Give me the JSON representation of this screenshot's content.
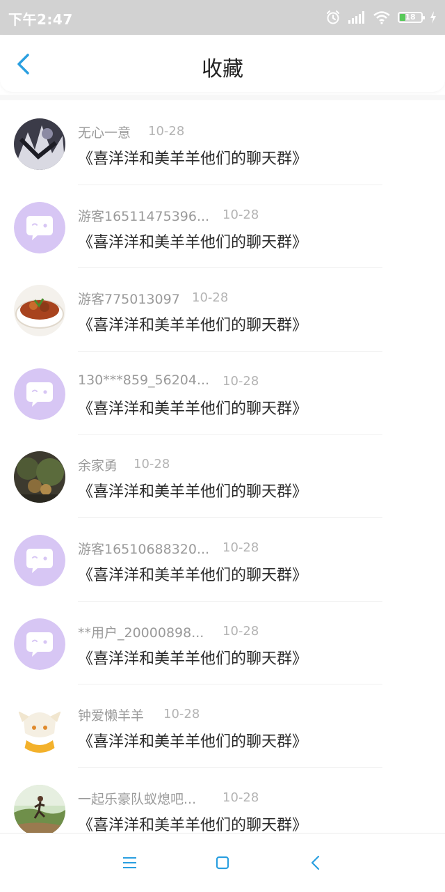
{
  "status": {
    "time": "下午2:47",
    "battery": "18"
  },
  "header": {
    "title": "收藏"
  },
  "items": [
    {
      "name": "无心一意",
      "date": "10-28",
      "message": "《喜洋洋和美羊羊他们的聊天群》"
    },
    {
      "name": "游客16511475396...",
      "date": "10-28",
      "message": "《喜洋洋和美羊羊他们的聊天群》"
    },
    {
      "name": "游客775013097",
      "date": "10-28",
      "message": "《喜洋洋和美羊羊他们的聊天群》"
    },
    {
      "name": "130***859_56204...",
      "date": "10-28",
      "message": "《喜洋洋和美羊羊他们的聊天群》"
    },
    {
      "name": "余家勇",
      "date": "10-28",
      "message": "《喜洋洋和美羊羊他们的聊天群》"
    },
    {
      "name": "游客16510688320...",
      "date": "10-28",
      "message": "《喜洋洋和美羊羊他们的聊天群》"
    },
    {
      "name": "**用户_20000898...",
      "date": "10-28",
      "message": "《喜洋洋和美羊羊他们的聊天群》"
    },
    {
      "name": "钟爱懒羊羊",
      "date": "10-28",
      "message": "《喜洋洋和美羊羊他们的聊天群》"
    },
    {
      "name": "一起乐豪队蚁熄吧...",
      "date": "10-28",
      "message": "《喜洋洋和美羊羊他们的聊天群》"
    }
  ],
  "colors": {
    "accent": "#2a9fe0",
    "default_avatar_bg": "#d7c6f4",
    "default_avatar_icon": "#ffffff"
  },
  "icons": {
    "back": "chevron-left-icon",
    "default_avatar": "chat-bubble-icon",
    "nav_menu": "menu-icon",
    "nav_home": "square-icon",
    "nav_back": "chevron-left-icon"
  }
}
